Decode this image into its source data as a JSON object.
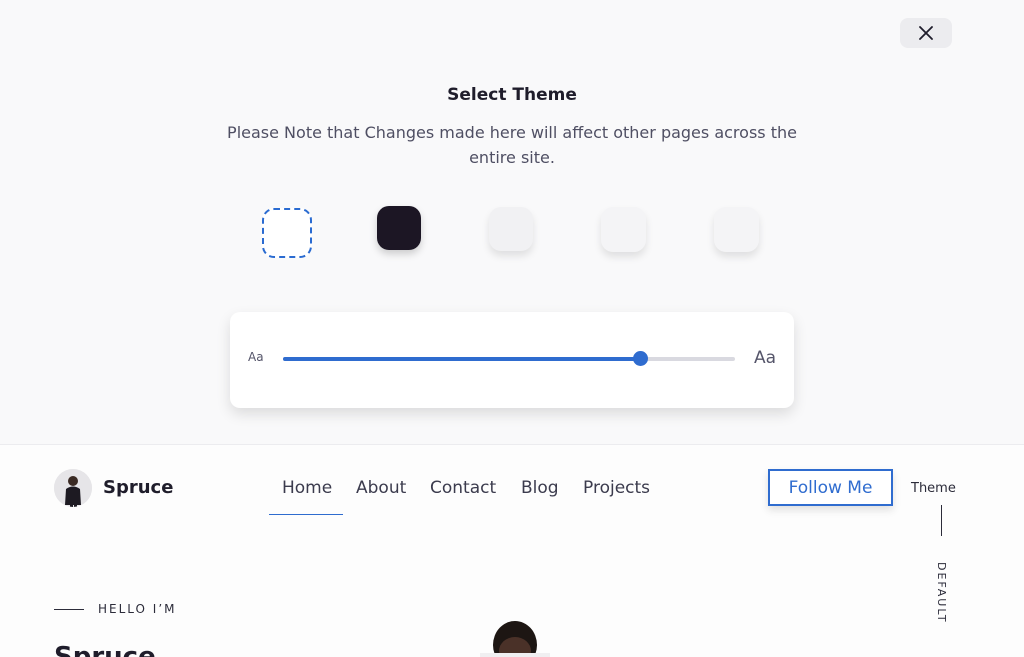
{
  "theme_selector": {
    "title": "Select Theme",
    "note": "Please Note that Changes made here will affect other pages across the entire site.",
    "swatches": [
      {
        "name": "white",
        "color": "#ffffff",
        "selected": true
      },
      {
        "name": "dark",
        "color": "#1c1624",
        "selected": false
      },
      {
        "name": "light-gray",
        "color": "#f1f1f3",
        "selected": false
      },
      {
        "name": "light-gray-2",
        "color": "#f4f4f6",
        "selected": false
      },
      {
        "name": "light-gray-3",
        "color": "#f4f4f6",
        "selected": false
      }
    ],
    "font_size": {
      "small_label": "Aa",
      "large_label": "Aa",
      "value_fraction": 0.79
    },
    "accent_color": "#2f6ccf"
  },
  "header": {
    "brand": "Spruce",
    "nav": [
      "Home",
      "About",
      "Contact",
      "Blog",
      "Projects"
    ],
    "active_nav": "Home",
    "follow_button": "Follow Me",
    "theme_label": "Theme",
    "theme_current": "DEFAULT"
  },
  "hero": {
    "eyebrow": "HELLO I’M",
    "name": "Spruce"
  }
}
